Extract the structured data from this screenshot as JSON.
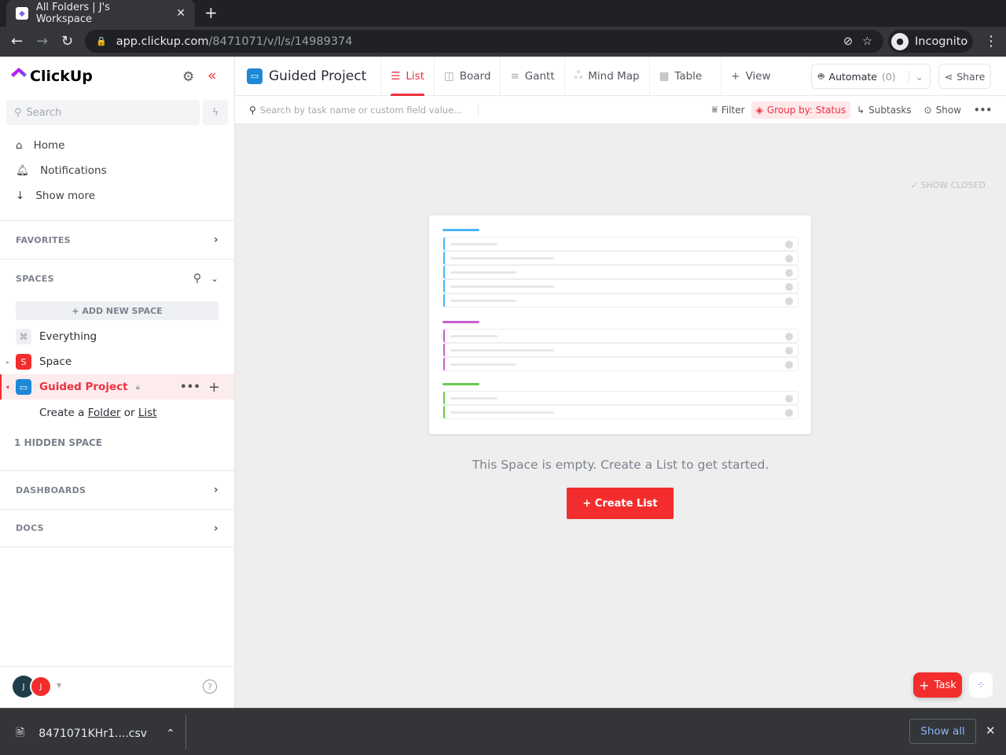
{
  "browser": {
    "tab_title": "All Folders | J's Workspace",
    "url_host": "app.clickup.com",
    "url_path": "/8471071/v/l/s/14989374",
    "incognito": "Incognito"
  },
  "sidebar": {
    "logo": "ClickUp",
    "search_placeholder": "Search",
    "nav": [
      {
        "label": "Home"
      },
      {
        "label": "Notifications"
      },
      {
        "label": "Show more"
      }
    ],
    "favorites": "FAVORITES",
    "spaces": "SPACES",
    "add_space": "+ ADD NEW SPACE",
    "space_items": [
      {
        "badge": "⌘",
        "label": "Everything"
      },
      {
        "badge": "S",
        "label": "Space"
      },
      {
        "badge": "▭",
        "label": "Guided Project"
      }
    ],
    "create_prefix": "Create a",
    "create_folder": "Folder",
    "create_or": "or",
    "create_list": "List",
    "hidden": "1 HIDDEN SPACE",
    "dashboards": "DASHBOARDS",
    "docs": "DOCS",
    "avatars": [
      "J",
      "J"
    ]
  },
  "header": {
    "title": "Guided Project",
    "views": [
      "List",
      "Board",
      "Gantt",
      "Mind Map",
      "Table"
    ],
    "add_view": "View",
    "automate": "Automate",
    "automate_count": "(0)",
    "share": "Share"
  },
  "toolbar": {
    "search_placeholder": "Search by task name or custom field value...",
    "filter": "Filter",
    "group_by": "Group by: Status",
    "subtasks": "Subtasks",
    "show": "Show"
  },
  "content": {
    "show_closed": "SHOW CLOSED",
    "empty_message": "This Space is empty. Create a List to get started.",
    "create_list": "+ Create List",
    "task_button": "Task"
  },
  "colors": {
    "accent": "#f32d2d",
    "blue": "#49b5f5",
    "purple": "#c55fd0",
    "green": "#6bc950"
  },
  "download": {
    "file": "8471071KHr1....csv",
    "show_all": "Show all"
  }
}
